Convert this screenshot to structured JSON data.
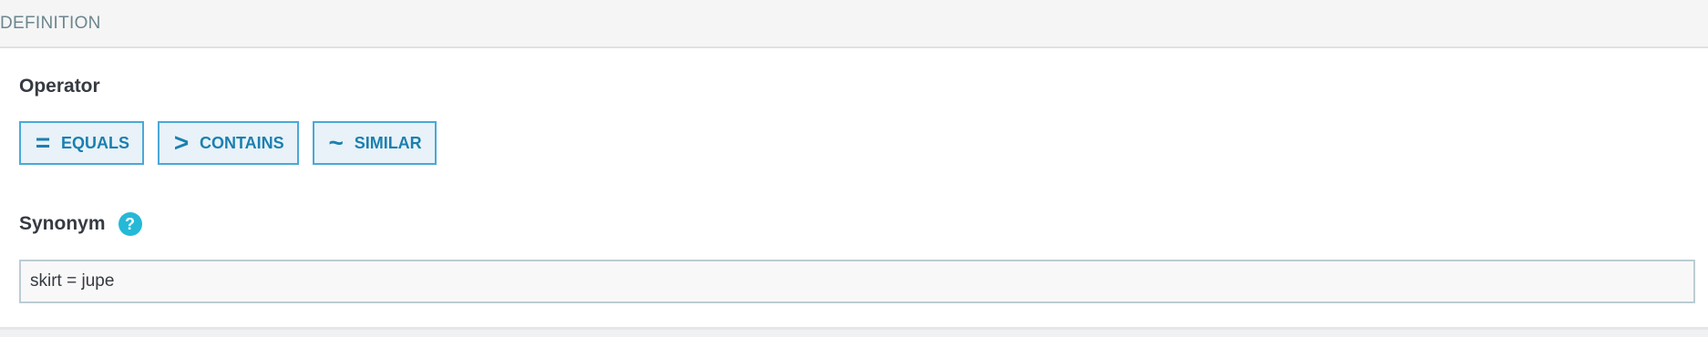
{
  "panel": {
    "heading": "DEFINITION"
  },
  "operator": {
    "label": "Operator",
    "options": [
      {
        "icon": "=",
        "label": "EQUALS",
        "icon_name": "equals-icon"
      },
      {
        "icon": ">",
        "label": "CONTAINS",
        "icon_name": "greater-than-icon"
      },
      {
        "icon": "~",
        "label": "SIMILAR",
        "icon_name": "tilde-icon"
      }
    ]
  },
  "synonym": {
    "label": "Synonym",
    "help_icon": "?",
    "value": "skirt = jupe"
  },
  "colors": {
    "accent": "#1b7fb0",
    "button_border": "#4aa8d8",
    "button_bg": "#e8f2f8",
    "help_icon": "#25b9d7"
  }
}
